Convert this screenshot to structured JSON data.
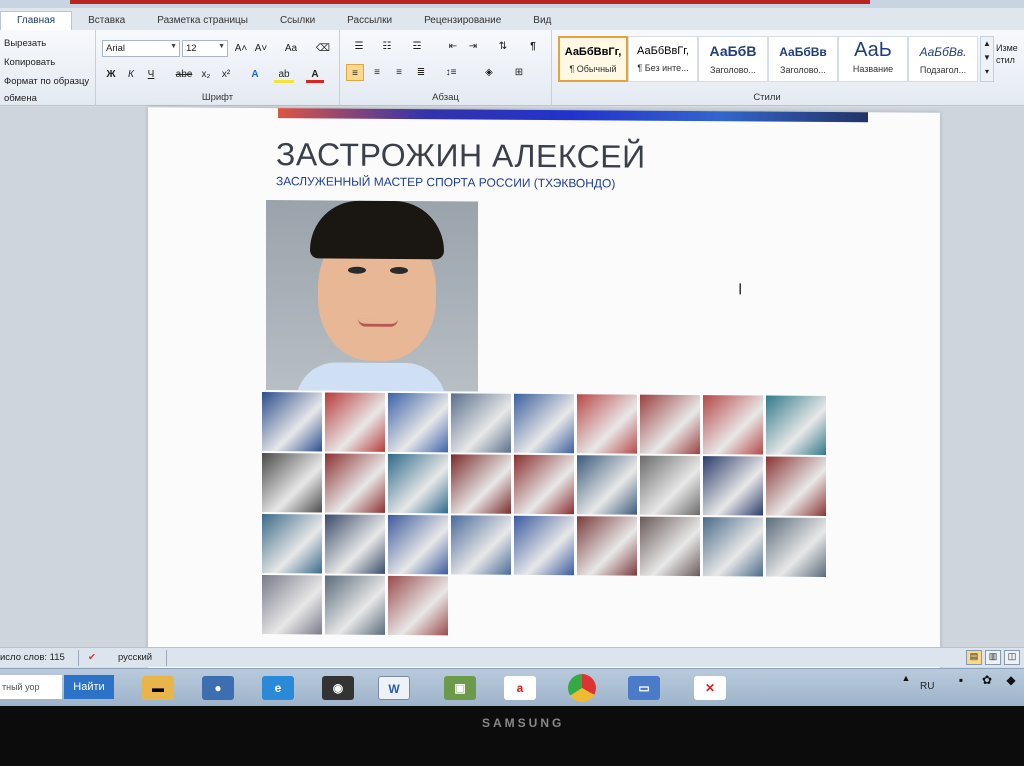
{
  "ribbon": {
    "tabs": [
      "Главная",
      "Вставка",
      "Разметка страницы",
      "Ссылки",
      "Рассылки",
      "Рецензирование",
      "Вид"
    ],
    "active_tab": 0,
    "clipboard": {
      "cut": "Вырезать",
      "copy": "Копировать",
      "format_painter": "Формат по образцу",
      "label": "обмена"
    },
    "font": {
      "family": "Arial",
      "size": "12",
      "label": "Шрифт",
      "bold": "Ж",
      "italic": "К",
      "underline": "Ч",
      "strike": "abe",
      "subscript": "x₂",
      "superscript": "x²",
      "grow": "A˄",
      "shrink": "A˅",
      "case": "Aa",
      "text_effects": "A",
      "highlight": "ab",
      "color": "A"
    },
    "paragraph": {
      "label": "Абзац"
    },
    "styles": {
      "label": "Стили",
      "items": [
        {
          "sample": "АаБбВвГг,",
          "name": "¶ Обычный"
        },
        {
          "sample": "АаБбВвГг,",
          "name": "¶ Без инте..."
        },
        {
          "sample": "АаБбВ",
          "name": "Заголово..."
        },
        {
          "sample": "АаБбВв",
          "name": "Заголово..."
        },
        {
          "sample": "АаЬ",
          "name": "Название"
        },
        {
          "sample": "АаБбВв.",
          "name": "Подзагол..."
        }
      ],
      "change_label": "Изме стил"
    }
  },
  "document": {
    "title": "ЗАСТРОЖИН АЛЕКСЕЙ",
    "subtitle": "ЗАСЛУЖЕННЫЙ МАСТЕР СПОРТА РОССИИ (ТХЭКВОНДО)"
  },
  "photo_colors": [
    "#2b4d8c",
    "#b83a3a",
    "#3c62a8",
    "#5a6f8c",
    "#3c5f9e",
    "#b84848",
    "#9a4040",
    "#b44646",
    "#2f7a8a",
    "#4a4a4a",
    "#8a3030",
    "#2e6a8a",
    "#7a2a2a",
    "#8a2e2e",
    "#3a5a7a",
    "#6a6a6a",
    "#2a3a6a",
    "#8a3434",
    "#3a6a8a",
    "#3a4a6a",
    "#3c5a9c",
    "#4a6a9a",
    "#3a5aa0",
    "#7a3a3a",
    "#6a5a5a",
    "#4a6a8a",
    "#5a6a7a",
    "#7a7a8a",
    "#5a6a7a",
    "#9a4a4a"
  ],
  "statusbar": {
    "word_count": "исло слов: 115",
    "language": "русский"
  },
  "taskbar": {
    "search_field": "тный уор",
    "search_button": "Найти",
    "apps": [
      "folder",
      "media",
      "ie",
      "app",
      "W",
      "app2",
      "a",
      "chrome",
      "screen",
      "x"
    ],
    "language": "RU"
  },
  "monitor_brand": "SAMSUNG"
}
